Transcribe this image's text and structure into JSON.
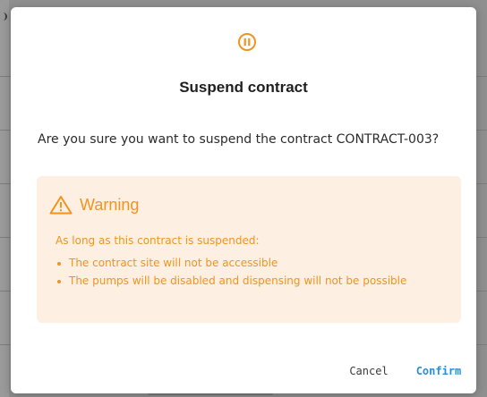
{
  "dialog": {
    "icon": "pause-circle-icon",
    "title": "Suspend contract",
    "message": "Are you sure you want to suspend the contract CONTRACT-003?",
    "warning": {
      "icon": "warning-triangle-icon",
      "title": "Warning",
      "intro": "As long as this contract is suspended:",
      "items": [
        "The contract site will not be accessible",
        "The pumps will be disabled and dispensing will not be possible"
      ]
    },
    "actions": {
      "cancel_label": "Cancel",
      "confirm_label": "Confirm"
    }
  },
  "colors": {
    "accent_orange": "#f0941f",
    "warning_background": "#fdefe2",
    "confirm_blue": "#2a8fd6",
    "backdrop": "#8f8f8f"
  }
}
